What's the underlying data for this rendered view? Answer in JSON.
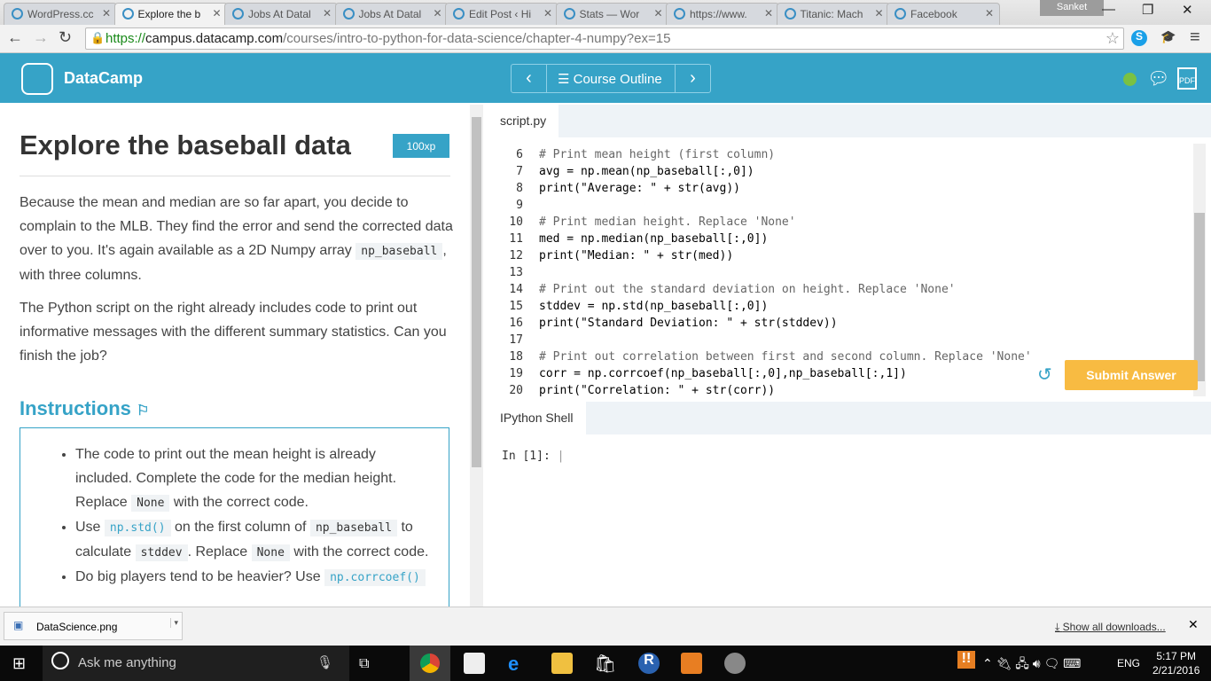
{
  "browser": {
    "tabs": [
      {
        "label": "WordPress.cc"
      },
      {
        "label": "Explore the b",
        "active": true
      },
      {
        "label": "Jobs At Datal"
      },
      {
        "label": "Jobs At Datal"
      },
      {
        "label": "Edit Post ‹ Hi"
      },
      {
        "label": "Stats — Wor"
      },
      {
        "label": "https://www."
      },
      {
        "label": "Titanic: Mach"
      },
      {
        "label": "Facebook"
      }
    ],
    "user": "Sanket",
    "url_scheme": "https://",
    "url_host": "campus.datacamp.com",
    "url_path": "/courses/intro-to-python-for-data-science/chapter-4-numpy?ex=15"
  },
  "header": {
    "brand": "DataCamp",
    "outline": "Course Outline",
    "status_color": "#7ac143",
    "accent": "#36a3c7"
  },
  "exercise": {
    "title": "Explore the baseball data",
    "xp": "100xp",
    "p1a": "Because the mean and median are so far apart, you decide to complain to the MLB. They find the error and send the corrected data over to you. It's again available as a 2D Numpy array ",
    "p1code": "np_baseball",
    "p1b": ", with three columns.",
    "p2": "The Python script on the right already includes code to print out informative messages with the different summary statistics. Can you finish the job?",
    "instructions_title": "Instructions",
    "i1a": "The code to print out the mean height is already included. Complete the code for the median height. Replace ",
    "i1code": "None",
    "i1b": " with the correct code.",
    "i2a": "Use ",
    "i2code1": "np.std()",
    "i2b": " on the first column of ",
    "i2code2": "np_baseball",
    "i2c": " to calculate ",
    "i2code3": "stddev",
    "i2d": ". Replace ",
    "i2code4": "None",
    "i2e": " with the correct code.",
    "i3a": "Do big players tend to be heavier? Use ",
    "i3code": "np.corrcoef()"
  },
  "editor": {
    "tab": "script.py",
    "lines": [
      {
        "n": "6",
        "t": "# Print mean height (first column)",
        "c": true
      },
      {
        "n": "7",
        "t": "avg = np.mean(np_baseball[:,0])"
      },
      {
        "n": "8",
        "t": "print(\"Average: \" + str(avg))"
      },
      {
        "n": "9",
        "t": ""
      },
      {
        "n": "10",
        "t": "# Print median height. Replace 'None'",
        "c": true
      },
      {
        "n": "11",
        "t": "med = np.median(np_baseball[:,0])"
      },
      {
        "n": "12",
        "t": "print(\"Median: \" + str(med))"
      },
      {
        "n": "13",
        "t": ""
      },
      {
        "n": "14",
        "t": "# Print out the standard deviation on height. Replace 'None'",
        "c": true
      },
      {
        "n": "15",
        "t": "stddev = np.std(np_baseball[:,0])"
      },
      {
        "n": "16",
        "t": "print(\"Standard Deviation: \" + str(stddev))"
      },
      {
        "n": "17",
        "t": ""
      },
      {
        "n": "18",
        "t": "# Print out correlation between first and second column. Replace 'None'",
        "c": true
      },
      {
        "n": "19",
        "t": "corr = np.corrcoef(np_baseball[:,0],np_baseball[:,1])"
      },
      {
        "n": "20",
        "t": "print(\"Correlation: \" + str(corr))"
      }
    ],
    "submit": "Submit Answer"
  },
  "shell": {
    "tab": "IPython Shell",
    "prompt": "In [1]:"
  },
  "downloads": {
    "file": "DataScience.png",
    "show_all": "Show all downloads..."
  },
  "taskbar": {
    "search": "Ask me anything",
    "lang": "ENG",
    "time": "5:17 PM",
    "date": "2/21/2016"
  }
}
